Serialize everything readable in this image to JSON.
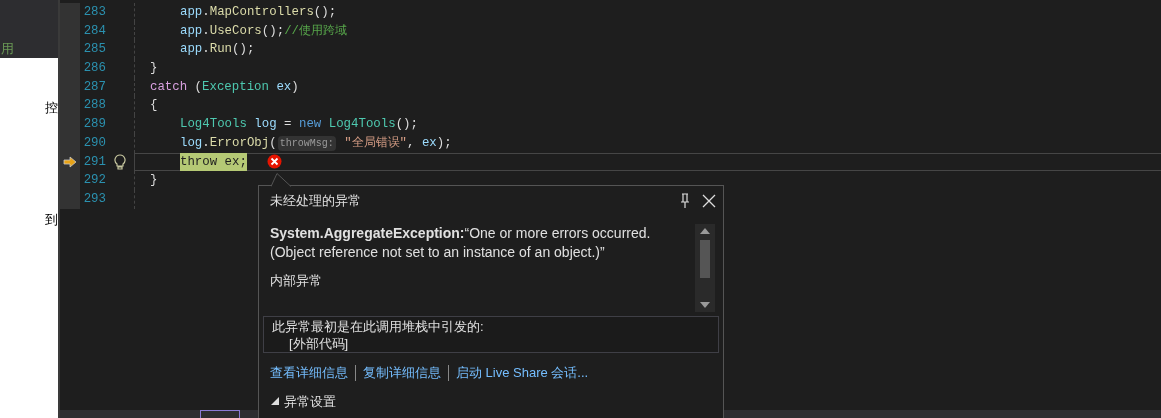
{
  "other_window": {
    "texts": [
      "用",
      "控",
      "到"
    ]
  },
  "editor": {
    "lines": [
      {
        "number": "283",
        "current": false,
        "indented": true,
        "tokens": [
          {
            "text": "app",
            "kind": "var"
          },
          {
            "text": "."
          },
          {
            "text": "MapControllers",
            "kind": "method"
          },
          {
            "text": "();"
          }
        ]
      },
      {
        "number": "284",
        "current": false,
        "indented": true,
        "tokens": [
          {
            "text": "app",
            "kind": "var"
          },
          {
            "text": "."
          },
          {
            "text": "UseCors",
            "kind": "method"
          },
          {
            "text": "();"
          },
          {
            "text": "//使用跨域",
            "kind": "comment"
          }
        ]
      },
      {
        "number": "285",
        "current": false,
        "indented": true,
        "tokens": [
          {
            "text": "app",
            "kind": "var"
          },
          {
            "text": "."
          },
          {
            "text": "Run",
            "kind": "method"
          },
          {
            "text": "();"
          }
        ]
      },
      {
        "number": "286",
        "current": false,
        "indented": false,
        "tokens": [
          {
            "text": "}"
          }
        ]
      },
      {
        "number": "287",
        "current": false,
        "indented": false,
        "tokens": [
          {
            "text": "catch",
            "kind": "control"
          },
          {
            "text": " ("
          },
          {
            "text": "Exception",
            "kind": "type"
          },
          {
            "text": " ex",
            "kind": "var"
          },
          {
            "text": ")"
          }
        ]
      },
      {
        "number": "288",
        "current": false,
        "indented": false,
        "tokens": [
          {
            "text": "{"
          }
        ]
      },
      {
        "number": "289",
        "current": false,
        "indented": true,
        "tokens": [
          {
            "text": "Log4Tools",
            "kind": "type"
          },
          {
            "text": " log",
            "kind": "var"
          },
          {
            "text": " = "
          },
          {
            "text": "new",
            "kind": "keyword"
          },
          {
            "text": " Log4Tools",
            "kind": "type"
          },
          {
            "text": "();"
          }
        ]
      },
      {
        "number": "290",
        "current": false,
        "indented": true,
        "tokens": [
          {
            "text": "log",
            "kind": "var"
          },
          {
            "text": "."
          },
          {
            "text": "ErrorObj",
            "kind": "method"
          },
          {
            "text": "("
          },
          {
            "text": "throwMsg:",
            "kind": "hint"
          },
          {
            "text": " \"全局错误\"",
            "kind": "string"
          },
          {
            "text": ", "
          },
          {
            "text": "ex",
            "kind": "var"
          },
          {
            "text": ");"
          }
        ]
      },
      {
        "number": "291",
        "current": true,
        "indented": true,
        "tokens": [
          {
            "text": "throw ex;",
            "kind": "highlight"
          }
        ]
      },
      {
        "number": "292",
        "current": false,
        "indented": false,
        "tokens": [
          {
            "text": "}"
          }
        ]
      },
      {
        "number": "293",
        "current": false
      }
    ]
  },
  "exception_popup": {
    "title": "未经处理的异常",
    "message": "**System.AggregateException:**“One or more errors occurred. (Object reference not set to an instance of an object.)”",
    "inner_label": "内部异常",
    "stack_heading": "此异常最初是在此调用堆栈中引发的:",
    "stack_frames": [
      "[外部代码]"
    ],
    "links": [
      "查看详细信息",
      "复制详细信息",
      "启动 Live Share 会话..."
    ],
    "settings": {
      "label": "异常设置",
      "expanded": true
    }
  }
}
